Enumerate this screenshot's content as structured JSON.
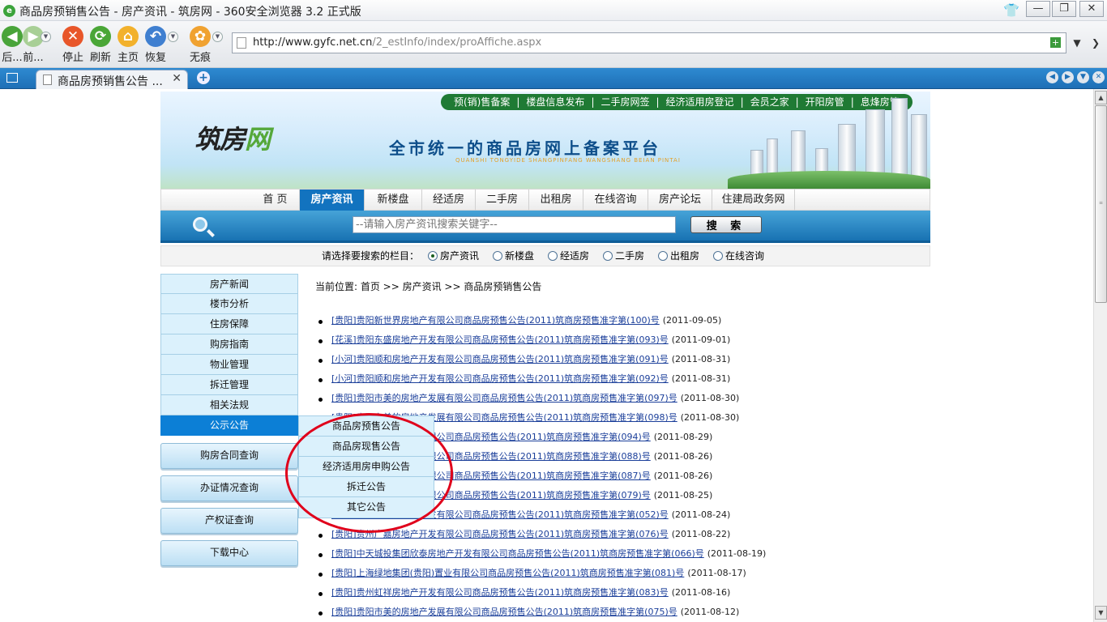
{
  "window": {
    "title": "商品房预销售公告 - 房产资讯 - 筑房网 - 360安全浏览器 3.2 正式版"
  },
  "toolbar": {
    "back": "后...",
    "forward": "前...",
    "stop": "停止",
    "refresh": "刷新",
    "home": "主页",
    "restore": "恢复",
    "incognito": "无痕"
  },
  "address": {
    "host": "http://www.gyfc.net.cn",
    "path": "/2_estInfo/index/proAffiche.aspx"
  },
  "tab": {
    "title": "商品房预销售公告 ..."
  },
  "site": {
    "logo_main": "筑房",
    "logo_accent": "网",
    "slogan": "全市统一的商品房网上备案平台",
    "slogan_pinyin": "QUANSHI TONGYIDE SHANGPINFANG WANGSHANG BEIAN PINTAI",
    "top_links": [
      "预(销)售备案",
      "|",
      "楼盘信息发布",
      "|",
      "二手房网签",
      "|",
      "经济适用房登记",
      "|",
      "会员之家",
      "|",
      "开阳房管",
      "|",
      "息烽房管"
    ]
  },
  "main_nav": [
    "首 页",
    "房产资讯",
    "新楼盘",
    "经适房",
    "二手房",
    "出租房",
    "在线咨询",
    "房产论坛",
    "住建局政务网"
  ],
  "search": {
    "placeholder": "--请输入房产资讯搜索关键字--",
    "button": "搜 索",
    "scope_label": "请选择要搜索的栏目：",
    "options": [
      "房产资讯",
      "新楼盘",
      "经适房",
      "二手房",
      "出租房",
      "在线咨询"
    ]
  },
  "sidebar": {
    "menu": [
      "房产新闻",
      "楼市分析",
      "住房保障",
      "购房指南",
      "物业管理",
      "拆迁管理",
      "相关法规",
      "公示公告"
    ],
    "big_buttons": [
      "购房合同查询",
      "办证情况查询",
      "产权证查询",
      "下载中心"
    ]
  },
  "submenu": [
    "商品房预售公告",
    "商品房现售公告",
    "经济适用房申购公告",
    "拆迁公告",
    "其它公告"
  ],
  "breadcrumb": "当前位置: 首页 >> 房产资讯 >> 商品房预销售公告",
  "news": [
    {
      "title": "[贵阳]贵阳新世界房地产有限公司商品房预售公告(2011)筑商房预售准字第(100)号",
      "date": "(2011-09-05)"
    },
    {
      "title": "[花溪]贵阳东盛房地产开发有限公司商品房预售公告(2011)筑商房预售准字第(093)号",
      "date": "(2011-09-01)"
    },
    {
      "title": "[小河]贵阳顺和房地产开发有限公司商品房预售公告(2011)筑商房预售准字第(091)号",
      "date": "(2011-08-31)"
    },
    {
      "title": "[小河]贵阳顺和房地产开发有限公司商品房预售公告(2011)筑商房预售准字第(092)号",
      "date": "(2011-08-31)"
    },
    {
      "title": "[贵阳]贵阳市美的房地产发展有限公司商品房预售公告(2011)筑商房预售准字第(097)号",
      "date": "(2011-08-30)"
    },
    {
      "title": "[贵阳]贵阳市美的房地产发展有限公司商品房预售公告(2011)筑商房预售准字第(098)号",
      "date": "(2011-08-30)"
    },
    {
      "title": "[贵阳]贵阳房地产开发有限公司商品房预售公告(2011)筑商房预售准字第(094)号",
      "date": "(2011-08-29)"
    },
    {
      "title": "[贵阳]贵阳房地产开发有限公司商品房预售公告(2011)筑商房预售准字第(088)号",
      "date": "(2011-08-26)"
    },
    {
      "title": "[贵阳]贵阳房地产开发有限公司商品房预售公告(2011)筑商房预售准字第(087)号",
      "date": "(2011-08-26)"
    },
    {
      "title": "[贵阳]贵阳房地产开发有限公司商品房预售公告(2011)筑商房预售准字第(079)号",
      "date": "(2011-08-25)"
    },
    {
      "title": "[贵阳]贵阳保利房地产开发有限公司商品房预售公告(2011)筑商房预售准字第(052)号",
      "date": "(2011-08-24)"
    },
    {
      "title": "[贵阳]贵州广嘉房地产开发有限公司商品房预售公告(2011)筑商房预售准字第(076)号",
      "date": "(2011-08-22)"
    },
    {
      "title": "[贵阳]中天城投集团欣泰房地产开发有限公司商品房预售公告(2011)筑商房预售准字第(066)号",
      "date": "(2011-08-19)"
    },
    {
      "title": "[贵阳]上海绿地集团(贵阳)置业有限公司商品房预售公告(2011)筑商房预售准字第(081)号",
      "date": "(2011-08-17)"
    },
    {
      "title": "[贵阳]贵州虹祥房地产开发有限公司商品房预售公告(2011)筑商房预售准字第(083)号",
      "date": "(2011-08-16)"
    },
    {
      "title": "[贵阳]贵阳市美的房地产发展有限公司商品房预售公告(2011)筑商房预售准字第(075)号",
      "date": "(2011-08-12)"
    }
  ],
  "colors": {
    "nav_active": "#1273bf",
    "sidebar_active": "#0c7fd6",
    "annotation_circle": "#e0001b",
    "link": "#1b3f9a"
  }
}
